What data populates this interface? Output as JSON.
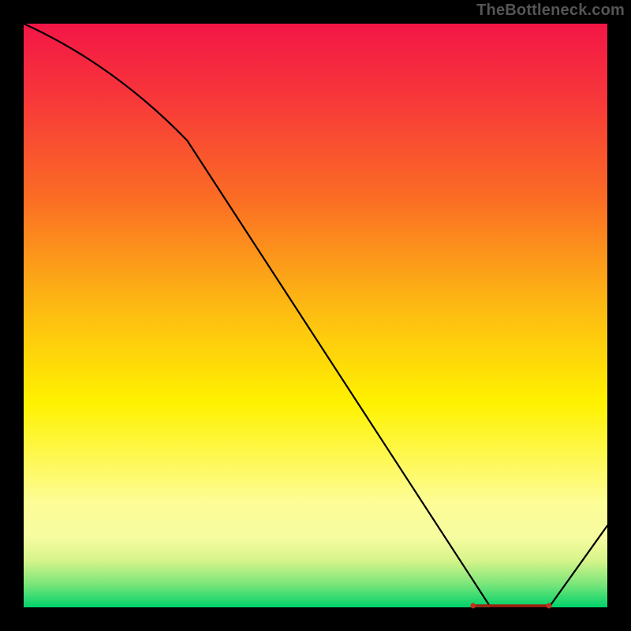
{
  "watermark": "TheBottleneck.com",
  "chart_data": {
    "type": "line",
    "title": "",
    "xlabel": "",
    "ylabel": "",
    "xlim": [
      0,
      100
    ],
    "ylim": [
      0,
      100
    ],
    "series": [
      {
        "name": "curve",
        "x": [
          0,
          28,
          80,
          90,
          100
        ],
        "values": [
          100,
          80,
          0,
          0,
          14
        ]
      }
    ],
    "segment_marker": {
      "x_start": 77,
      "x_end": 90,
      "y": 0
    },
    "gradient_stops": [
      {
        "pct": 0,
        "color": "#f31646"
      },
      {
        "pct": 12,
        "color": "#f7353b"
      },
      {
        "pct": 30,
        "color": "#fb6d24"
      },
      {
        "pct": 48,
        "color": "#fdb813"
      },
      {
        "pct": 65,
        "color": "#fff200"
      },
      {
        "pct": 82,
        "color": "#fdfd96"
      },
      {
        "pct": 88,
        "color": "#f6fca0"
      },
      {
        "pct": 92,
        "color": "#d6f48a"
      },
      {
        "pct": 96,
        "color": "#7be67a"
      },
      {
        "pct": 100,
        "color": "#00d26a"
      }
    ]
  }
}
